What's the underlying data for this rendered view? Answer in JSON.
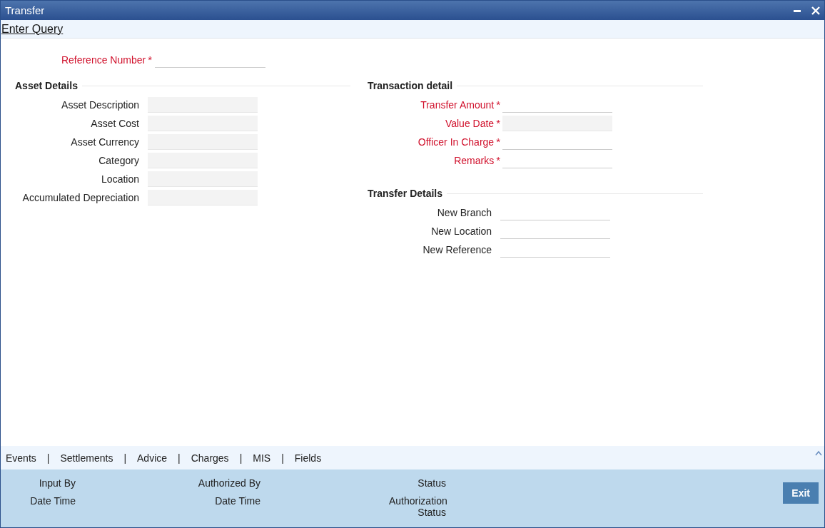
{
  "window": {
    "title": "Transfer"
  },
  "toolbar": {
    "link": "Enter Query"
  },
  "reference": {
    "label": "Reference Number",
    "required": true,
    "required_mark": "*",
    "kind": "editable"
  },
  "asset_details": {
    "title": "Asset Details",
    "fields": [
      {
        "label": "Asset Description",
        "required": false,
        "kind": "readonly"
      },
      {
        "label": "Asset Cost",
        "required": false,
        "kind": "readonly"
      },
      {
        "label": "Asset Currency",
        "required": false,
        "kind": "readonly"
      },
      {
        "label": "Category",
        "required": false,
        "kind": "readonly"
      },
      {
        "label": "Location",
        "required": false,
        "kind": "readonly"
      },
      {
        "label": "Accumulated Depreciation",
        "required": false,
        "kind": "readonly"
      }
    ]
  },
  "transaction_detail": {
    "title": "Transaction detail",
    "fields": [
      {
        "label": "Transfer Amount",
        "required": true,
        "required_mark": "*",
        "kind": "editable"
      },
      {
        "label": "Value Date",
        "required": true,
        "required_mark": "*",
        "kind": "readonly"
      },
      {
        "label": "Officer In Charge",
        "required": true,
        "required_mark": "*",
        "kind": "editable"
      },
      {
        "label": "Remarks",
        "required": true,
        "required_mark": "*",
        "kind": "editable"
      }
    ]
  },
  "transfer_details": {
    "title": "Transfer Details",
    "fields": [
      {
        "label": "New Branch",
        "required": false,
        "kind": "editable"
      },
      {
        "label": "New Location",
        "required": false,
        "kind": "editable"
      },
      {
        "label": "New Reference",
        "required": false,
        "kind": "editable"
      }
    ]
  },
  "footer_tabs": {
    "items": [
      "Events",
      "Settlements",
      "Advice",
      "Charges",
      "MIS",
      "Fields"
    ],
    "separator": "|"
  },
  "audit": {
    "columns": [
      [
        "Input By",
        "Date Time"
      ],
      [
        "Authorized By",
        "Date Time"
      ],
      [
        "Status",
        "Authorization Status"
      ]
    ]
  },
  "buttons": {
    "exit": "Exit"
  }
}
